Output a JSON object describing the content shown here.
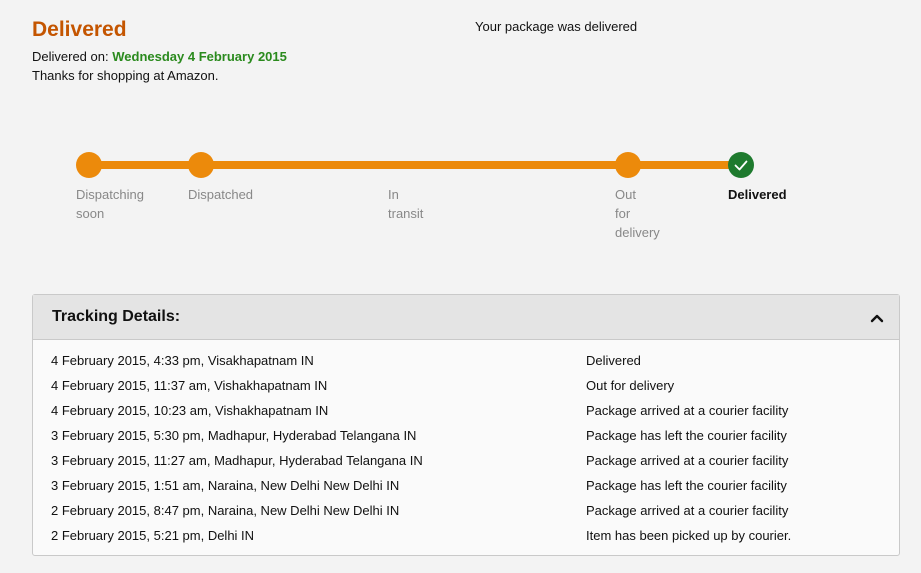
{
  "header": {
    "status_title": "Delivered",
    "delivered_on_label": "Delivered on:",
    "delivered_on_date": "Wednesday 4 February 2015",
    "thanks": "Thanks for shopping at Amazon.",
    "package_message": "Your package was delivered"
  },
  "tracker": {
    "steps": [
      {
        "line1": "Dispatching",
        "line2": "soon",
        "line3": "",
        "state": "complete"
      },
      {
        "line1": "Dispatched",
        "line2": "",
        "line3": "",
        "state": "complete"
      },
      {
        "line1": "In",
        "line2": "transit",
        "line3": "",
        "state": "complete"
      },
      {
        "line1": "Out",
        "line2": "for",
        "line3": "delivery",
        "state": "complete"
      },
      {
        "line1": "Delivered",
        "line2": "",
        "line3": "",
        "state": "current"
      }
    ],
    "accent_color": "#ec8a0b",
    "done_color": "#1e7a2e"
  },
  "tracking_details": {
    "title": "Tracking Details:",
    "collapse_icon": "chevron-up-icon",
    "events": [
      {
        "when": "4 February 2015, 4:33 pm, Visakhapatnam IN",
        "what": "Delivered"
      },
      {
        "when": "4 February 2015, 11:37 am, Vishakhapatnam IN",
        "what": "Out for delivery"
      },
      {
        "when": "4 February 2015, 10:23 am, Vishakhapatnam IN",
        "what": "Package arrived at a courier facility"
      },
      {
        "when": "3 February 2015, 5:30 pm, Madhapur, Hyderabad Telangana IN",
        "what": "Package has left the courier facility"
      },
      {
        "when": "3 February 2015, 11:27 am, Madhapur, Hyderabad Telangana IN",
        "what": "Package arrived at a courier facility"
      },
      {
        "when": "3 February 2015, 1:51 am, Naraina, New Delhi New Delhi IN",
        "what": "Package has left the courier facility"
      },
      {
        "when": "2 February 2015, 8:47 pm, Naraina, New Delhi New Delhi IN",
        "what": "Package arrived at a courier facility"
      },
      {
        "when": "2 February 2015, 5:21 pm, Delhi IN",
        "what": "Item has been picked up by courier."
      }
    ]
  }
}
